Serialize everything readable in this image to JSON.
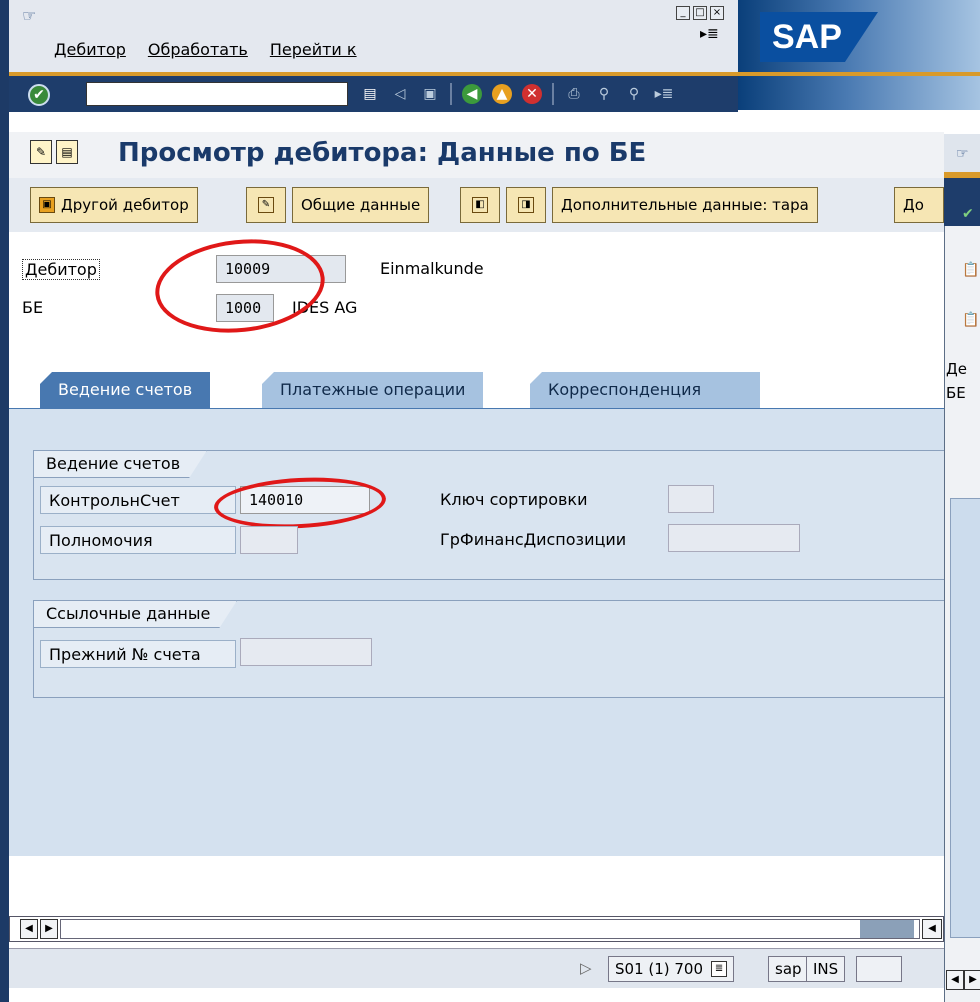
{
  "menu": {
    "items": [
      "Дебитор",
      "Обработать",
      "Перейти к"
    ]
  },
  "title": "Просмотр дебитора: Данные по БЕ",
  "app_toolbar": {
    "other_debtor": "Другой дебитор",
    "general_data": "Общие данные",
    "extra_data": "Дополнительные данные: тара",
    "cut_label": "До"
  },
  "header": {
    "debtor_label": "Дебитор",
    "debtor_value": "10009",
    "debtor_name": "Einmalkunde",
    "be_label": "БЕ",
    "be_value": "1000",
    "be_name": "IDES AG"
  },
  "tabs": [
    {
      "label": "Ведение счетов",
      "active": true
    },
    {
      "label": "Платежные операции",
      "active": false
    },
    {
      "label": "Корреспонденция",
      "active": false
    }
  ],
  "group1": {
    "title": "Ведение счетов",
    "control_account_label": "КонтрольнСчет",
    "control_account_value": "140010",
    "authority_label": "Полномочия",
    "sort_key_label": "Ключ сортировки",
    "fin_group_label": "ГрФинансДиспозиции"
  },
  "group2": {
    "title": "Ссылочные данные",
    "prev_account_label": "Прежний № счета"
  },
  "status": {
    "system": "S01 (1) 700",
    "server": "sap",
    "mode": "INS"
  },
  "bg_window": {
    "label1": "Де",
    "label2": "БЕ"
  },
  "colors": {
    "sap_blue": "#1e3d6b",
    "active_tab": "#4878b0",
    "panel": "#d4e1ef",
    "highlight": "#e01818"
  }
}
